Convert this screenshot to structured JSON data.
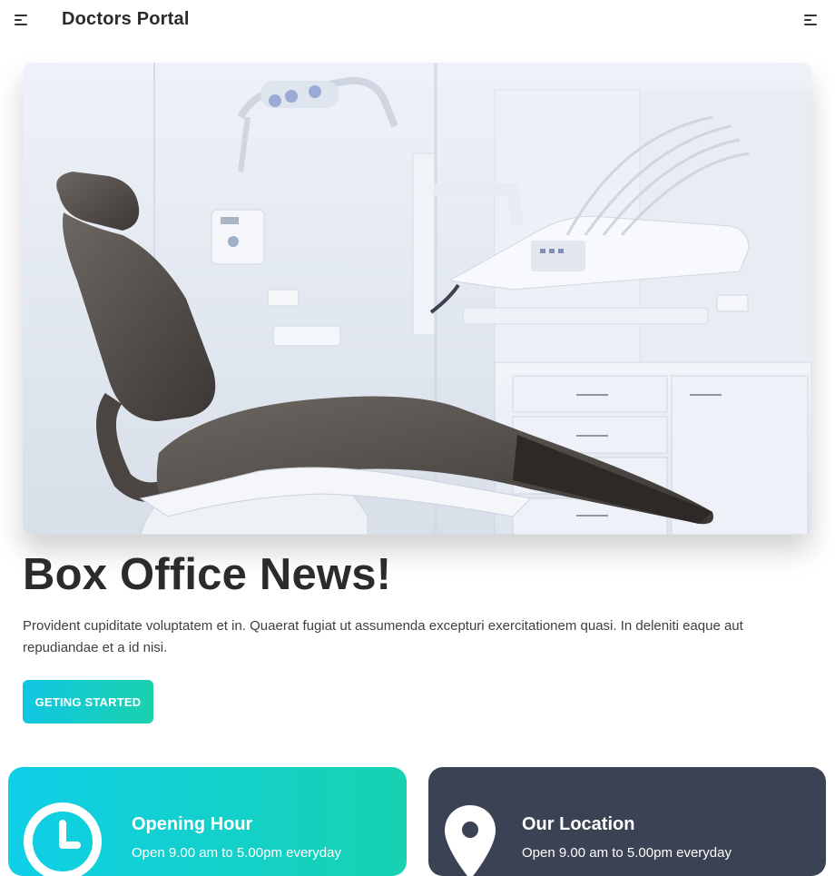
{
  "header": {
    "brand": "Doctors Portal",
    "left_icon": "menu-icon",
    "right_icon": "menu-icon"
  },
  "hero": {
    "image_subject": "dental-chair-photo",
    "title": "Box Office News!",
    "description": "Provident cupiditate voluptatem et in. Quaerat fugiat ut assumenda excepturi exercitationem quasi. In deleniti eaque aut repudiandae et a id nisi.",
    "cta_label": "GETING STARTED"
  },
  "cards": {
    "hours": {
      "icon": "clock-icon",
      "title": "Opening Hour",
      "text": "Open 9.00 am to 5.00pm everyday"
    },
    "location": {
      "icon": "location-pin-icon",
      "title": "Our Location",
      "text": "Open 9.00 am to 5.00pm everyday"
    }
  },
  "colors": {
    "accent_start": "#10c7e3",
    "accent_end": "#1ad1ad",
    "dark_card": "#3b4253",
    "heading": "#2b2b2b"
  }
}
